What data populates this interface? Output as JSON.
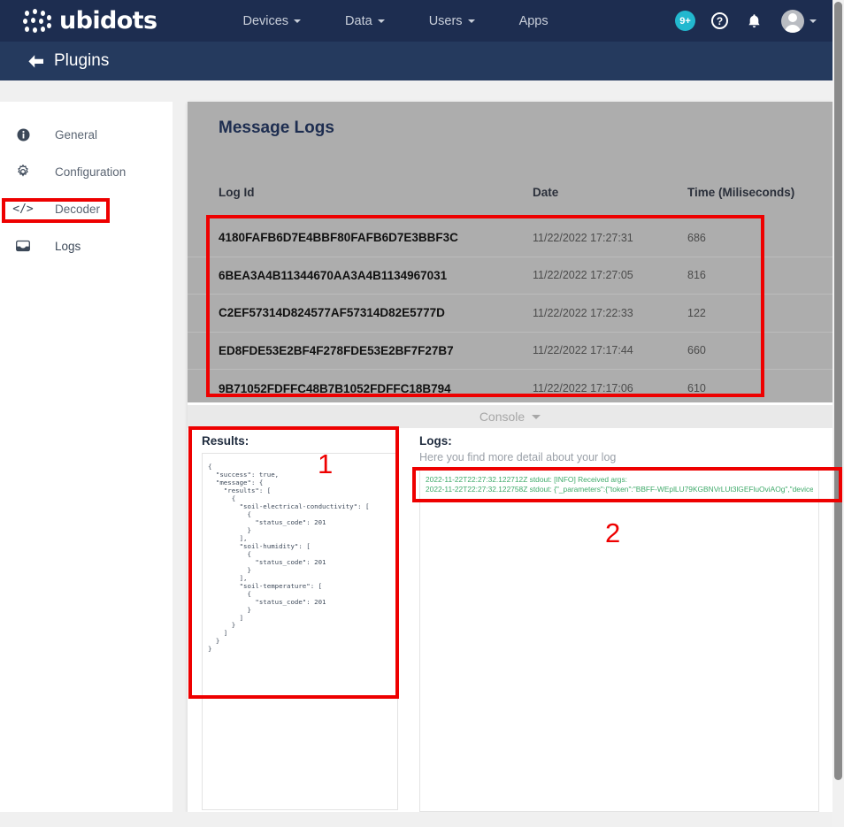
{
  "topnav": {
    "brand": "ubidots",
    "links": [
      {
        "label": "Devices",
        "has_caret": true
      },
      {
        "label": "Data",
        "has_caret": true
      },
      {
        "label": "Users",
        "has_caret": true
      },
      {
        "label": "Apps",
        "has_caret": false
      }
    ],
    "notification_badge": "9+",
    "help_icon": "?",
    "icons": [
      "bell-icon",
      "avatar-icon"
    ],
    "accent_badge_color": "#22b8cf",
    "bar_color": "#1d2d50"
  },
  "subheader": {
    "title": "Plugins",
    "back_icon": "arrow-left-icon",
    "bar_color": "#253a5e"
  },
  "sidebar": {
    "items": [
      {
        "label": "General",
        "icon": "info-icon",
        "active": false
      },
      {
        "label": "Configuration",
        "icon": "gear-icon",
        "active": false
      },
      {
        "label": "Decoder",
        "icon": "code-icon",
        "active": false
      },
      {
        "label": "Logs",
        "icon": "inbox-icon",
        "active": true
      }
    ]
  },
  "main": {
    "title": "Message Logs",
    "table": {
      "columns": [
        "Log Id",
        "Date",
        "Time (Miliseconds)"
      ],
      "rows": [
        {
          "log_id": "4180FAFB6D7E4BBF80FAFB6D7E3BBF3C",
          "date": "11/22/2022 17:27:31",
          "time": "686"
        },
        {
          "log_id": "6BEA3A4B11344670AA3A4B1134967031",
          "date": "11/22/2022 17:27:05",
          "time": "816"
        },
        {
          "log_id": "C2EF57314D824577AF57314D82E5777D",
          "date": "11/22/2022 17:22:33",
          "time": "122"
        },
        {
          "log_id": "ED8FDE53E2BF4F278FDE53E2BF7F27B7",
          "date": "11/22/2022 17:17:44",
          "time": "660"
        },
        {
          "log_id": "9B71052FDFFC48B7B1052FDFFC18B794",
          "date": "11/22/2022 17:17:06",
          "time": "610"
        }
      ]
    },
    "console": {
      "label": "Console",
      "caret_icon": "chevron-down-icon"
    },
    "results_panel": {
      "title": "Results:",
      "content": "{\n  \"success\": true,\n  \"message\": {\n    \"results\": [\n      {\n        \"soil-electrical-conductivity\": [\n          {\n            \"status_code\": 201\n          }\n        ],\n        \"soil-humidity\": [\n          {\n            \"status_code\": 201\n          }\n        ],\n        \"soil-temperature\": [\n          {\n            \"status_code\": 201\n          }\n        ]\n      }\n    ]\n  }\n}"
    },
    "logs_panel": {
      "title": "Logs:",
      "subtitle": "Here you find more detail about your log",
      "lines": [
        "2022-11-22T22:27:32.122712Z stdout: [INFO] Received args:",
        "2022-11-22T22:27:32.122758Z stdout: {\"_parameters\":{\"token\":\"BBFF-WEplLU79KGBNVrLUt3lGEFluOviAOg\",\"device_"
      ]
    }
  },
  "annotations": {
    "marker_1": "1",
    "marker_2": "2",
    "color": "#ee0000"
  }
}
